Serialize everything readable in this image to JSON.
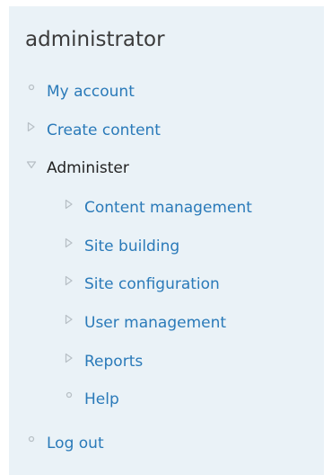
{
  "block": {
    "title": "administrator"
  },
  "menu": {
    "my_account": "My account",
    "create_content": "Create content",
    "administer": "Administer",
    "content_management": "Content management",
    "site_building": "Site building",
    "site_configuration": "Site configuration",
    "user_management": "User management",
    "reports": "Reports",
    "help": "Help",
    "log_out": "Log out"
  },
  "icons": {
    "leaf": "leaf-bullet-icon",
    "collapsed": "collapsed-arrow-icon",
    "expanded": "expanded-arrow-icon"
  },
  "colors": {
    "link": "#2a7ab9",
    "active_text": "#222222",
    "background": "#eaf2f7",
    "marker": "#b8c0c6"
  }
}
